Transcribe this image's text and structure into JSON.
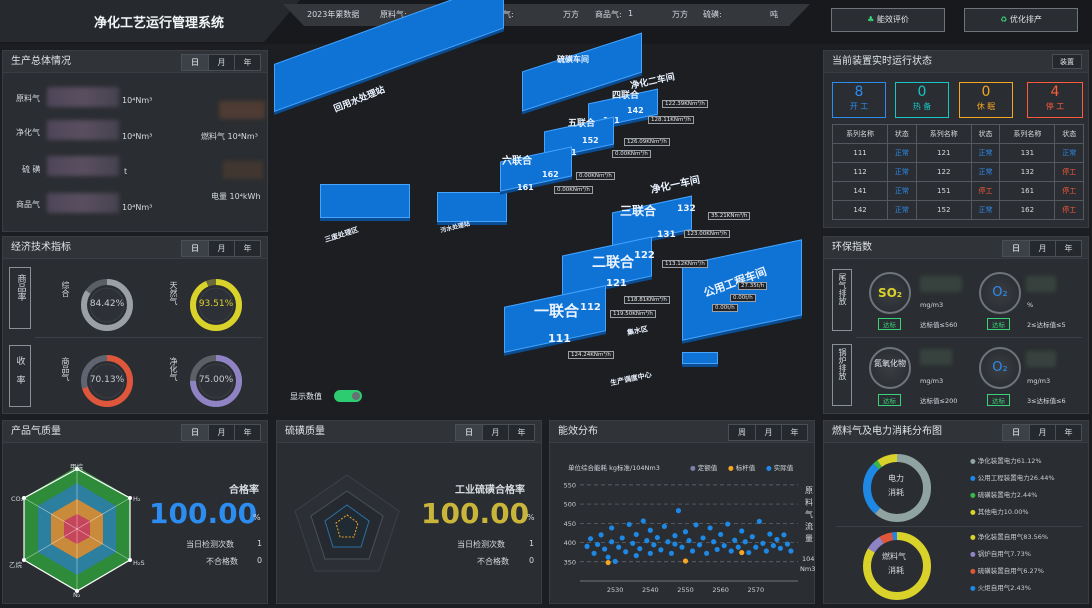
{
  "header": {
    "title": "净化工艺运行管理系统",
    "summary": {
      "year_label": "2023年累数据",
      "items": [
        {
          "label": "原料气:",
          "unit": "万方"
        },
        {
          "label": "净化气:",
          "unit": "万方"
        },
        {
          "label": "商品气:",
          "value": "1",
          "unit": "万方"
        },
        {
          "label": "硫磺:",
          "unit": "吨"
        }
      ]
    },
    "btn_energy": "能效评价",
    "btn_optimize": "优化排产"
  },
  "production": {
    "title": "生产总体情况",
    "tabs": [
      "日",
      "月",
      "年"
    ],
    "rows": [
      {
        "label": "原料气",
        "unit": "10⁴Nm³"
      },
      {
        "label": "净化气",
        "unit": "10⁴Nm³"
      },
      {
        "label": "硫 磺",
        "unit": "t"
      },
      {
        "label": "商品气",
        "unit": "10⁴Nm³"
      }
    ],
    "fuel_label": "燃料气 10⁴Nm³",
    "power_label": "电量 10⁴kWh"
  },
  "economy": {
    "title": "经济技术指标",
    "tabs": [
      "日",
      "月",
      "年"
    ],
    "group1": "商品率",
    "group2": "收率",
    "gauges": [
      {
        "name": "综合",
        "value": "84.42%",
        "pct": 84.42,
        "color": "#9aa0a6",
        "track": "#5a5f66"
      },
      {
        "name": "天然气",
        "value": "93.51%",
        "pct": 93.51,
        "color": "#d9d22a",
        "track": "#6b6a3a"
      },
      {
        "name": "商品气",
        "value": "70.13%",
        "pct": 70.13,
        "color": "#e0563a",
        "track": "#5f6470"
      },
      {
        "name": "净化气",
        "value": "75.00%",
        "pct": 75.0,
        "color": "#8f83c4",
        "track": "#5c5f66"
      }
    ]
  },
  "plant": {
    "blocks": [
      {
        "text": "四联合",
        "num": "141"
      },
      {
        "text": "五联合",
        "num": "151"
      },
      {
        "text": "六联合",
        "num": "161"
      },
      {
        "text": "三联合",
        "num": "131"
      },
      {
        "text": "二联合",
        "num": "121"
      },
      {
        "text": "一联合",
        "num": "111"
      }
    ],
    "nums_top": [
      "142",
      "152",
      "162",
      "132",
      "122",
      "112"
    ],
    "areas": [
      "净化二车间",
      "净化一车间",
      "公用工程车间",
      "回用水处理站",
      "硫磺车间",
      "污水处理站",
      "三废处理区",
      "集水区",
      "生产调度中心"
    ],
    "flows": [
      "122.39KNm³/h",
      "128.11KNm³/h",
      "126.09KNm³/h",
      "0.00KNm³/h",
      "0.00KNm³/h",
      "0.00KNm³/h",
      "35.21KNm³/h",
      "123.00KNm³/h",
      "113.12KNm³/h",
      "118.81KNm³/h",
      "119.50KNm³/h",
      "124.24KNm³/h",
      "27.35t/h",
      "0.00t/h",
      "0.00t/h"
    ],
    "toggle_label": "显示数值"
  },
  "status": {
    "title": "当前装置实时运行状态",
    "btn": "装置",
    "counters": [
      {
        "num": "8",
        "label": "开 工",
        "color": "#2d8cf0"
      },
      {
        "num": "0",
        "label": "热 备",
        "color": "#19c6c6"
      },
      {
        "num": "0",
        "label": "休 眠",
        "color": "#f5a623"
      },
      {
        "num": "4",
        "label": "停 工",
        "color": "#ff5b3a"
      }
    ],
    "headers": [
      "系列名称",
      "状态",
      "系列名称",
      "状态",
      "系列名称",
      "状态"
    ],
    "rows": [
      [
        [
          "111",
          "正常"
        ],
        [
          "121",
          "正常"
        ],
        [
          "131",
          "正常"
        ]
      ],
      [
        [
          "112",
          "正常"
        ],
        [
          "122",
          "正常"
        ],
        [
          "132",
          "停工"
        ]
      ],
      [
        [
          "141",
          "正常"
        ],
        [
          "151",
          "停工"
        ],
        [
          "161",
          "停工"
        ]
      ],
      [
        [
          "142",
          "正常"
        ],
        [
          "152",
          "正常"
        ],
        [
          "162",
          "停工"
        ]
      ]
    ]
  },
  "env": {
    "title": "环保指数",
    "tabs": [
      "日",
      "月",
      "年"
    ],
    "group1": "尾气排放",
    "group2": "锅炉排放",
    "items": [
      {
        "name": "SO₂",
        "unit": "mg/m3",
        "badge": "达标",
        "limit": "达标值≤560"
      },
      {
        "name": "O₂",
        "unit": "%",
        "badge": "达标",
        "limit": "2≤达标值≤5"
      },
      {
        "name": "氮氧化物",
        "unit": "mg/m3",
        "badge": "达标",
        "limit": "达标值≤200"
      },
      {
        "name": "O₂",
        "unit": "mg/m3",
        "badge": "达标",
        "limit": "3≤达标值≤6"
      }
    ]
  },
  "quality": {
    "title": "产品气质量",
    "tabs": [
      "日",
      "月",
      "年"
    ],
    "axes": [
      "甲烷",
      "H₂",
      "H₂S",
      "N₂",
      "乙烷",
      "CO₂"
    ],
    "rate_label": "合格率",
    "rate": "100.00",
    "pct": "%",
    "count_label": "当日检测次数",
    "count": "1",
    "fail_label": "不合格数",
    "fail": "0"
  },
  "sulfur": {
    "title": "硫磺质量",
    "tabs": [
      "日",
      "月",
      "年"
    ],
    "rate_label": "工业硫磺合格率",
    "rate": "100.00",
    "pct": "%",
    "count_label": "当日检测次数",
    "count": "1",
    "fail_label": "不合格数",
    "fail": "0"
  },
  "energy": {
    "title": "能效分布",
    "tabs": [
      "周",
      "月",
      "年"
    ],
    "unit_label": "单位综合能耗 kg标准/104Nm3",
    "legend": [
      {
        "name": "定额值",
        "color": "#7a7fa8"
      },
      {
        "name": "标杆值",
        "color": "#f5a623"
      },
      {
        "name": "实际值",
        "color": "#1e88e5"
      }
    ],
    "side_label": [
      "原",
      "料",
      "气",
      "流",
      "量"
    ],
    "side_unit1": "104",
    "side_unit2": "Nm3",
    "colors": {
      "dot": "#1e88e5",
      "bench": "#f5a623"
    }
  },
  "chart_data": {
    "type": "scatter",
    "xlim": [
      2520,
      2582
    ],
    "ylim": [
      300,
      560
    ],
    "xticks": [
      "2530",
      "2540",
      "2550",
      "2560",
      "2570"
    ],
    "yticks": [
      "350",
      "400",
      "450",
      "500",
      "550"
    ],
    "series": [
      {
        "name": "实际值",
        "points": [
          [
            2522,
            390
          ],
          [
            2523,
            410
          ],
          [
            2524,
            372
          ],
          [
            2525,
            395
          ],
          [
            2526,
            420
          ],
          [
            2527,
            383
          ],
          [
            2528,
            362
          ],
          [
            2529,
            402
          ],
          [
            2529,
            438
          ],
          [
            2530,
            351
          ],
          [
            2531,
            388
          ],
          [
            2532,
            412
          ],
          [
            2533,
            376
          ],
          [
            2534,
            447
          ],
          [
            2535,
            398
          ],
          [
            2536,
            366
          ],
          [
            2536,
            421
          ],
          [
            2537,
            384
          ],
          [
            2538,
            456
          ],
          [
            2539,
            405
          ],
          [
            2540,
            372
          ],
          [
            2540,
            432
          ],
          [
            2541,
            394
          ],
          [
            2542,
            413
          ],
          [
            2543,
            381
          ],
          [
            2544,
            442
          ],
          [
            2545,
            402
          ],
          [
            2546,
            372
          ],
          [
            2547,
            418
          ],
          [
            2547,
            396
          ],
          [
            2548,
            483
          ],
          [
            2549,
            388
          ],
          [
            2550,
            428
          ],
          [
            2551,
            405
          ],
          [
            2552,
            378
          ],
          [
            2553,
            446
          ],
          [
            2554,
            394
          ],
          [
            2555,
            412
          ],
          [
            2556,
            372
          ],
          [
            2557,
            438
          ],
          [
            2558,
            402
          ],
          [
            2559,
            382
          ],
          [
            2560,
            421
          ],
          [
            2561,
            392
          ],
          [
            2562,
            448
          ],
          [
            2563,
            378
          ],
          [
            2564,
            406
          ],
          [
            2565,
            388
          ],
          [
            2566,
            430
          ],
          [
            2567,
            402
          ],
          [
            2568,
            374
          ],
          [
            2569,
            415
          ],
          [
            2570,
            388
          ],
          [
            2571,
            455
          ],
          [
            2572,
            398
          ],
          [
            2573,
            378
          ],
          [
            2574,
            422
          ],
          [
            2575,
            392
          ],
          [
            2576,
            408
          ],
          [
            2577,
            385
          ],
          [
            2578,
            420
          ],
          [
            2579,
            396
          ],
          [
            2580,
            378
          ]
        ]
      },
      {
        "name": "标杆值",
        "points": [
          [
            2528,
            348
          ],
          [
            2550,
            352
          ],
          [
            2566,
            374
          ]
        ]
      }
    ],
    "reference_lines": [
      400,
      450,
      500
    ]
  },
  "fuel": {
    "title": "燃料气及电力消耗分布图",
    "tabs": [
      "日",
      "月",
      "年"
    ],
    "donut1": {
      "label1": "电力",
      "label2": "消耗"
    },
    "donut2": {
      "label1": "燃料气",
      "label2": "消耗"
    },
    "legend1": [
      {
        "name": "净化装置电力61.12%",
        "color": "#8fa3a0"
      },
      {
        "name": "公用工程装置电力26.44%",
        "color": "#1e88e5"
      },
      {
        "name": "硫磺装置电力2.44%",
        "color": "#39b54a"
      },
      {
        "name": "其他电力10.00%",
        "color": "#d9d22a"
      }
    ],
    "legend2": [
      {
        "name": "净化装置自用气83.56%",
        "color": "#d9d22a"
      },
      {
        "name": "锅炉自用气7.73%",
        "color": "#8f83c4"
      },
      {
        "name": "硫磺装置自用气6.27%",
        "color": "#e0563a"
      },
      {
        "name": "火炬自用气2.43%",
        "color": "#1e88e5"
      }
    ]
  }
}
